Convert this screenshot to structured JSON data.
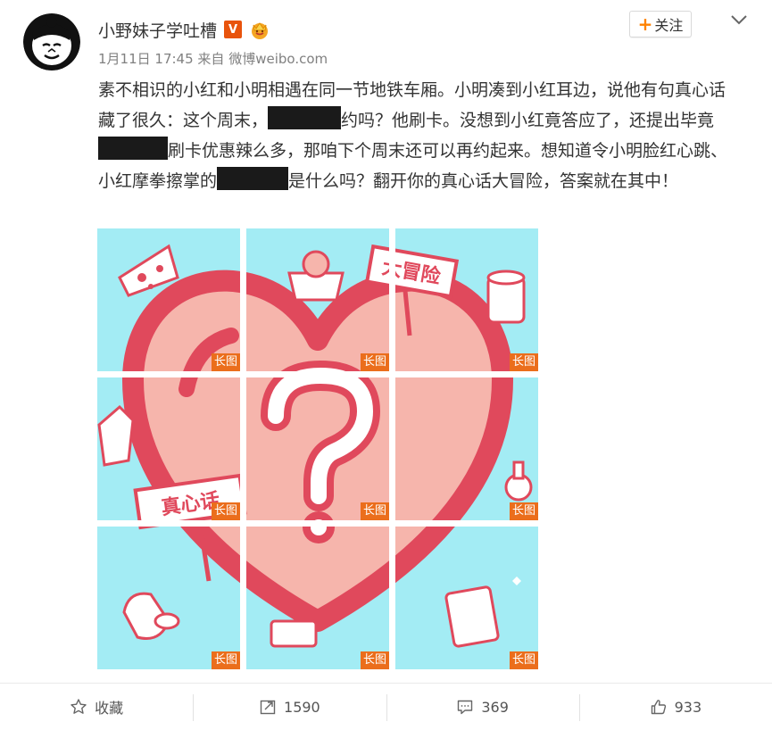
{
  "post": {
    "username": "小野妹子学吐槽",
    "verified_badge": "V",
    "time": "1月11日 17:45",
    "source_prefix": "来自",
    "source": "微博weibo.com",
    "follow_label": "关注",
    "text": {
      "p1": "素不相识的小红和小明相遇在同一节地铁车厢。小明凑到小红耳边，说他有句真心话藏了很久：这个周末，",
      "p2": "约吗？他刷卡。没想到小红竟答应了，还提出毕竟",
      "p3": "刷卡优惠辣么多，那咱下个周末还可以再约起来。想知道令小明脸红心跳、小红摩拳擦掌的",
      "p4": "是什么吗？翻开你的真心话大冒险，答案就在其中！"
    },
    "image_tag": "长图",
    "sign_adventure": "大冒险",
    "sign_truth": "真心话"
  },
  "actions": {
    "favorite": "收藏",
    "repost": "1590",
    "comment": "369",
    "like": "933"
  },
  "colors": {
    "accent": "#ff8200",
    "tag": "#eb6e1c",
    "grid_bg": "#a3ecf4",
    "heart": "#e0495c",
    "heart_fill": "#f6b5ac"
  },
  "icons": [
    "avatar",
    "verified-icon",
    "crown-icon",
    "chevron-down-icon",
    "star-icon",
    "repost-icon",
    "comment-icon",
    "like-icon"
  ]
}
